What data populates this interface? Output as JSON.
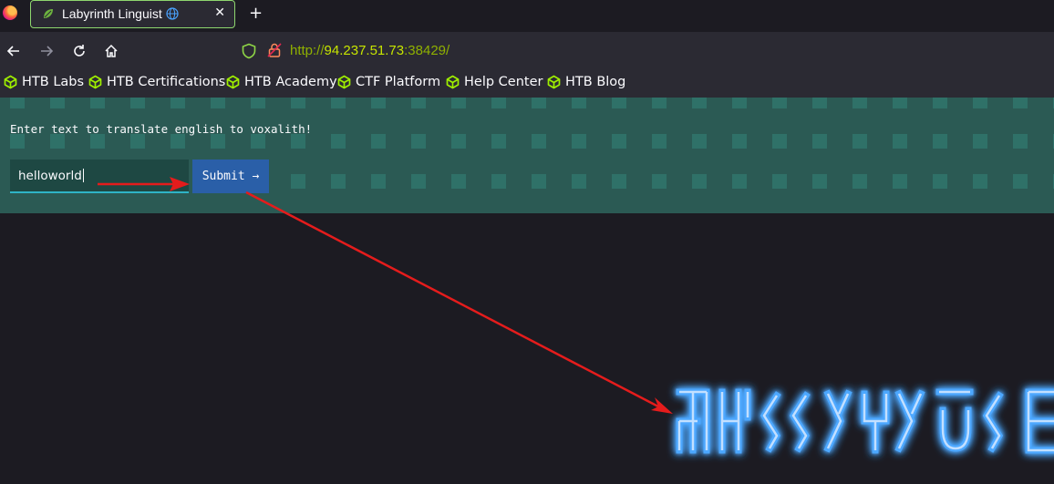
{
  "browser": {
    "tab_title": "Labyrinth Linguist",
    "tab_globe_icon": "globe-icon",
    "url_prefix": "http://",
    "url_host": "94.237.51.73",
    "url_port_path": ":38429/"
  },
  "bookmarks": [
    {
      "label": "HTB Labs"
    },
    {
      "label": "HTB Certifications"
    },
    {
      "label": "HTB Academy"
    },
    {
      "label": "CTF Platform"
    },
    {
      "label": "Help Center"
    },
    {
      "label": "HTB Blog"
    }
  ],
  "page": {
    "prompt": "Enter text to translate english to voxalith!",
    "input_value": "helloworld",
    "submit_label": "Submit →",
    "output_glyph_count": 10
  },
  "colors": {
    "hero_bg": "#2b5a54",
    "glyph_glow": "#1e90ff",
    "annotation_arrow": "#e51c1c"
  }
}
